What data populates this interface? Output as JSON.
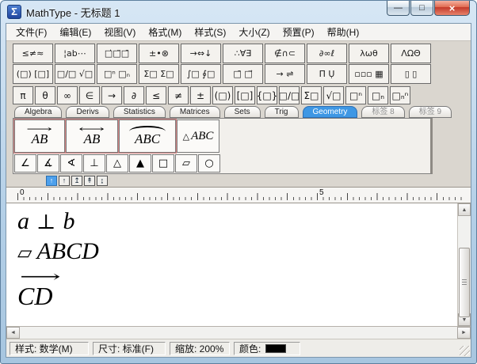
{
  "window": {
    "title": "MathType - 无标题 1",
    "icon_glyph": "Σ",
    "controls": {
      "minimize": "—",
      "maximize": "□",
      "close": "×"
    }
  },
  "menu": [
    "文件(F)",
    "编辑(E)",
    "视图(V)",
    "格式(M)",
    "样式(S)",
    "大小(Z)",
    "预置(P)",
    "帮助(H)"
  ],
  "toolbar": {
    "symbol_row": [
      "≤≠≈",
      "¦ab⋯",
      "□̇□̈□̄",
      "±•⊗",
      "→⇔↓",
      "∴∀∃",
      "∉∩⊂",
      "∂∞ℓ",
      "λωθ",
      "ΛΩΘ"
    ],
    "template_row": [
      "(□) [□]",
      "□∕□ √□",
      "□ⁿ □ₙ",
      "Σ□ Σ□",
      "∫□ ∮□",
      "□̄ □⃗",
      "→ ⇌",
      "Π̈ Ụ",
      "▫▫▫ ▦",
      "▯ ▯"
    ],
    "quick_row": [
      "π",
      "θ",
      "∞",
      "∈",
      "→",
      "∂",
      "≤",
      "≠",
      "±",
      "(□)",
      "[□]",
      "{□}",
      "□∕□",
      "Σ□",
      "√□",
      "□ⁿ",
      "□ₙ",
      "□ₙⁿ"
    ],
    "tabs": [
      {
        "label": "Algebra"
      },
      {
        "label": "Derivs"
      },
      {
        "label": "Statistics"
      },
      {
        "label": "Matrices"
      },
      {
        "label": "Sets"
      },
      {
        "label": "Trig"
      },
      {
        "label": "Geometry",
        "state": "active"
      },
      {
        "label": "标签 8",
        "state": "dim"
      },
      {
        "label": "标签 9",
        "state": "dim"
      }
    ],
    "geometry_large": [
      {
        "letters": "AB",
        "accent": "⟶"
      },
      {
        "letters": "AB",
        "accent": "⟷"
      },
      {
        "letters": "ABC",
        "accent": "arc"
      },
      {
        "prefix": "△",
        "letters": "ABC"
      }
    ],
    "geometry_small": [
      "∠",
      "∡",
      "∢",
      "⊥",
      "△",
      "▲",
      "□",
      "▱",
      "○"
    ],
    "mini_bar": [
      {
        "label": "↑",
        "state": "active"
      },
      {
        "label": "↑"
      },
      {
        "label": "↥"
      },
      {
        "label": "↟"
      },
      {
        "label": "↨"
      }
    ]
  },
  "ruler": {
    "label_zero": "0",
    "label_five": "5"
  },
  "canvas": {
    "eq1": {
      "lhs": "a",
      "op": "⊥",
      "rhs": "b"
    },
    "eq2": {
      "symbol": "▱",
      "letters": "ABCD"
    },
    "eq3": {
      "letters": "CD",
      "accent": "⟶"
    }
  },
  "scrollbars": {
    "up": "▲",
    "down": "▼",
    "left": "◄",
    "right": "►"
  },
  "statusbar": {
    "style": "样式: 数学(M)",
    "size": "尺寸: 标准(F)",
    "zoom": "缩放: 200%",
    "color_label": "颜色:",
    "color_value": "#000000"
  },
  "colors": {
    "active_tab": "#3e97e4",
    "template_highlight": "#d98585",
    "title_accent": "#b3cfe7"
  }
}
